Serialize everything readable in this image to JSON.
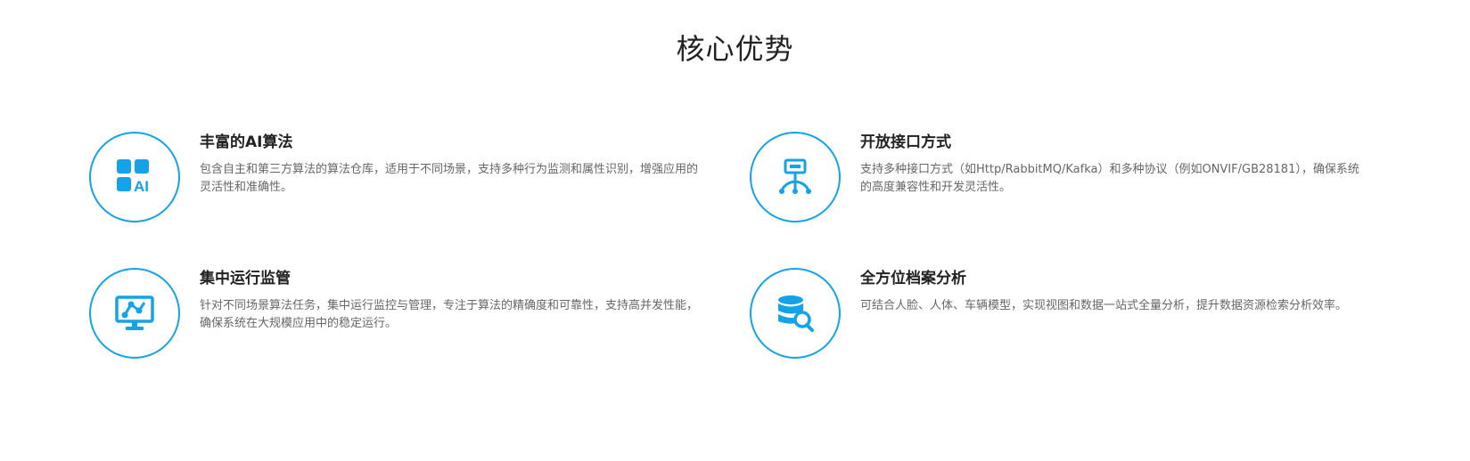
{
  "section": {
    "title": "核心优势"
  },
  "features": [
    {
      "icon": "ai-algorithm-icon",
      "title": "丰富的AI算法",
      "icon_text": "AI",
      "description": "包含自主和第三方算法的算法仓库，适用于不同场景，支持多种行为监测和属性识别，增强应用的灵活性和准确性。"
    },
    {
      "icon": "interface-tree-icon",
      "title": "开放接口方式",
      "description": "支持多种接口方式（如Http/RabbitMQ/Kafka）和多种协议（例如ONVIF/GB28181），确保系统的高度兼容性和开发灵活性。"
    },
    {
      "icon": "monitor-network-icon",
      "title": "集中运行监管",
      "description": "针对不同场景算法任务，集中运行监控与管理，专注于算法的精确度和可靠性，支持高并发性能，确保系统在大规模应用中的稳定运行。"
    },
    {
      "icon": "database-search-icon",
      "title": "全方位档案分析",
      "description": "可结合人脸、人体、车辆模型，实现视图和数据一站式全量分析，提升数据资源检索分析效率。"
    }
  ],
  "colors": {
    "accent": "#14a2e8",
    "title": "#222222",
    "text": "#666666"
  }
}
